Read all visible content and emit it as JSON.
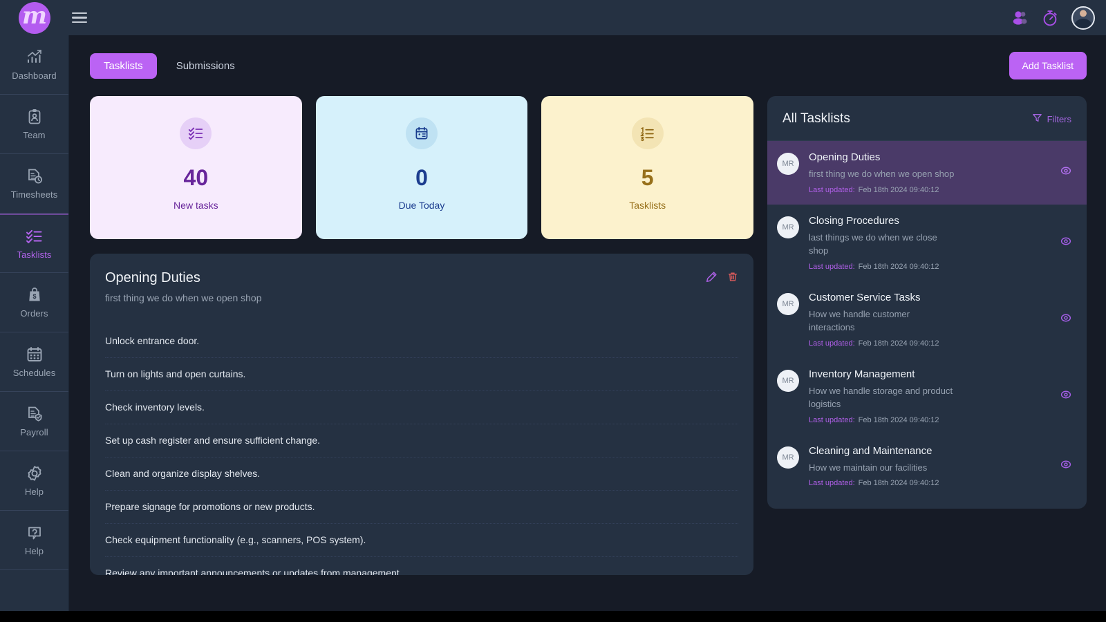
{
  "brand": {
    "logo_letter": "m",
    "menu_icon": "hamburger-icon"
  },
  "topbar": {
    "users_icon": "users-icon",
    "timer_icon": "stopwatch-icon",
    "avatar": "user-avatar"
  },
  "sidebar": {
    "items": [
      {
        "label": "Dashboard",
        "icon": "chart-bar-icon",
        "active": false
      },
      {
        "label": "Team",
        "icon": "clipboard-user-icon",
        "active": false
      },
      {
        "label": "Timesheets",
        "icon": "document-clock-icon",
        "active": false
      },
      {
        "label": "Tasklists",
        "icon": "checklist-icon",
        "active": true
      },
      {
        "label": "Orders",
        "icon": "shopping-bag-dollar-icon",
        "active": false
      },
      {
        "label": "Schedules",
        "icon": "calendar-icon",
        "active": false
      },
      {
        "label": "Payroll",
        "icon": "document-shield-icon",
        "active": false
      },
      {
        "label": "Help",
        "icon": "question-bubble-icon",
        "active": false
      }
    ]
  },
  "tabs": [
    {
      "label": "Tasklists",
      "active": true
    },
    {
      "label": "Submissions",
      "active": false
    }
  ],
  "actions": {
    "add_tasklist": "Add Tasklist"
  },
  "stats": [
    {
      "value": "40",
      "label": "New tasks",
      "icon": "checklist-icon",
      "theme": "c-purple"
    },
    {
      "value": "0",
      "label": "Due Today",
      "icon": "calendar-icon",
      "theme": "c-blue"
    },
    {
      "value": "5",
      "label": "Tasklists",
      "icon": "ordered-list-icon",
      "theme": "c-yellow"
    }
  ],
  "detail": {
    "title": "Opening Duties",
    "subtitle": "first thing we do when we open shop",
    "edit_icon": "pencil-icon",
    "delete_icon": "trash-icon",
    "tasks": [
      "Unlock entrance door.",
      "Turn on lights and open curtains.",
      "Check inventory levels.",
      "Set up cash register and ensure sufficient change.",
      "Clean and organize display shelves.",
      "Prepare signage for promotions or new products.",
      "Check equipment functionality (e.g., scanners, POS system).",
      "Review any important announcements or updates from management."
    ]
  },
  "panel": {
    "title": "All Tasklists",
    "filters_label": "Filters",
    "filters_icon": "funnel-icon",
    "updated_label": "Last updated:",
    "items": [
      {
        "initials": "MR",
        "name": "Opening Duties",
        "description": "first thing we do when we open shop",
        "updated": "Feb 18th 2024 09:40:12",
        "selected": true
      },
      {
        "initials": "MR",
        "name": "Closing Procedures",
        "description": "last things we do when we close shop",
        "updated": "Feb 18th 2024 09:40:12",
        "selected": false
      },
      {
        "initials": "MR",
        "name": "Customer Service Tasks",
        "description": "How we handle customer interactions",
        "updated": "Feb 18th 2024 09:40:12",
        "selected": false
      },
      {
        "initials": "MR",
        "name": "Inventory Management",
        "description": "How we handle storage and product logistics",
        "updated": "Feb 18th 2024 09:40:12",
        "selected": false
      },
      {
        "initials": "MR",
        "name": "Cleaning and Maintenance",
        "description": "How we maintain our facilities",
        "updated": "Feb 18th 2024 09:40:12",
        "selected": false
      }
    ]
  },
  "colors": {
    "accent": "#bb63f4",
    "sidebar_bg": "#253142",
    "page_bg": "#161b26",
    "card_purple": "#f7ebfd",
    "card_blue": "#d6f1fb",
    "card_yellow": "#fcf2cd",
    "selected_row": "#4a3a68",
    "delete": "#e05c5c"
  }
}
